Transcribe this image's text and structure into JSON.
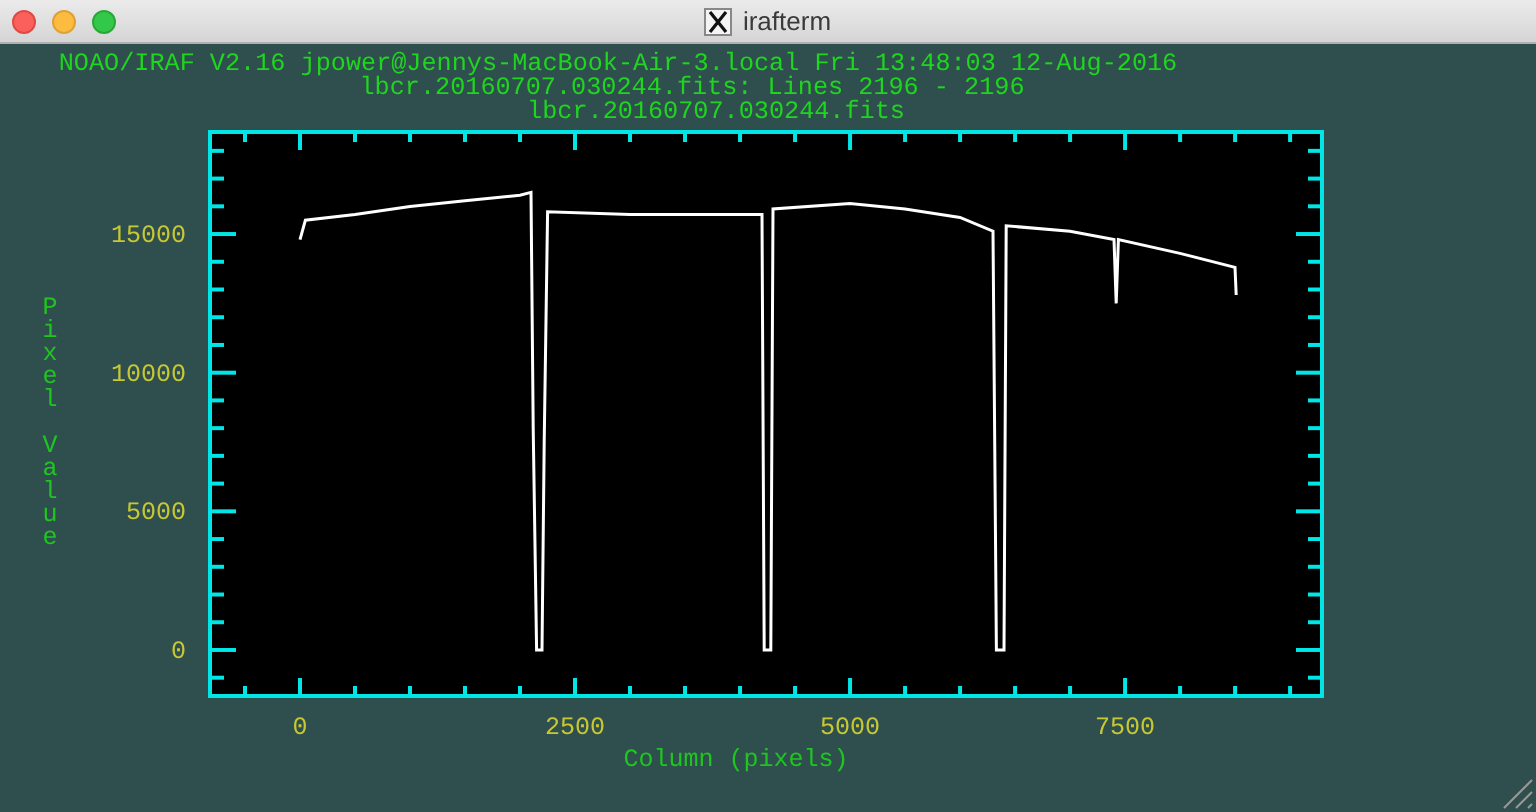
{
  "window": {
    "title": "irafterm"
  },
  "header": [
    "NOAO/IRAF V2.16 jpower@Jennys-MacBook-Air-3.local Fri 13:48:03 12-Aug-2016",
    "lbcr.20160707.030244.fits: Lines 2196 - 2196"
  ],
  "plot": {
    "chart_data": {
      "type": "line",
      "title": "lbcr.20160707.030244.fits",
      "xlabel": "Column (pixels)",
      "ylabel": "Pixel Value",
      "x": [
        0,
        50,
        500,
        1000,
        1500,
        2000,
        2100,
        2120,
        2150,
        2200,
        2220,
        2250,
        3000,
        4000,
        4200,
        4220,
        4280,
        4300,
        5000,
        5500,
        6000,
        6300,
        6330,
        6400,
        6420,
        7000,
        7400,
        7420,
        7440,
        8000,
        8500,
        8510
      ],
      "series": [
        {
          "color": "#ffffff",
          "values": [
            14800,
            15500,
            15700,
            16000,
            16200,
            16400,
            16500,
            8000,
            0,
            0,
            7500,
            15800,
            15700,
            15700,
            15700,
            0,
            0,
            15900,
            16100,
            15900,
            15600,
            15100,
            0,
            0,
            15300,
            15100,
            14800,
            12500,
            14800,
            14300,
            13800,
            12800
          ]
        }
      ],
      "xlim": [
        -818,
        9290
      ],
      "ylim": [
        -1660,
        18680
      ],
      "xticks": [
        {
          "value": 0,
          "label": "0"
        },
        {
          "value": 2500,
          "label": "2500"
        },
        {
          "value": 5000,
          "label": "5000"
        },
        {
          "value": 7500,
          "label": "7500"
        }
      ],
      "yticks": [
        {
          "value": 0,
          "label": "0"
        },
        {
          "value": 5000,
          "label": "5000"
        },
        {
          "value": 10000,
          "label": "10000"
        },
        {
          "value": 15000,
          "label": "15000"
        }
      ]
    }
  }
}
